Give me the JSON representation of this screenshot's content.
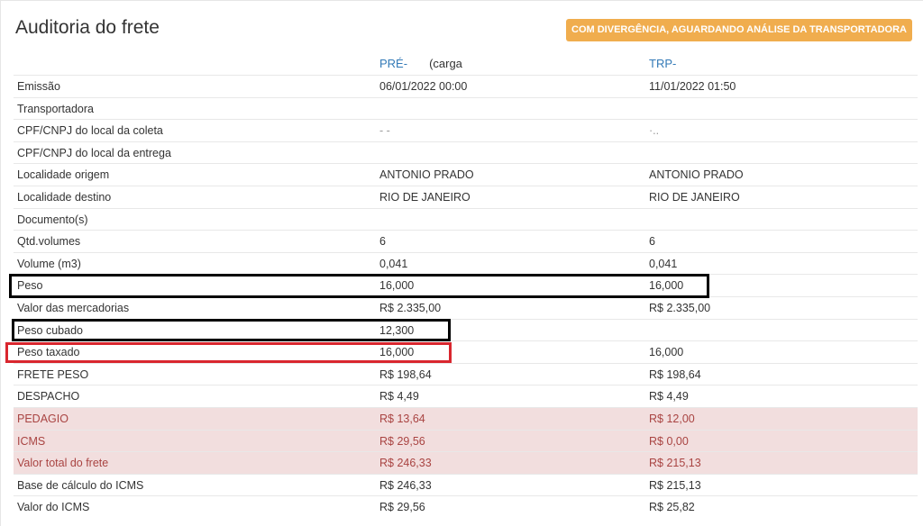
{
  "page": {
    "title": "Auditoria do frete"
  },
  "status_badge": "COM DIVERGÊNCIA, AGUARDANDO ANÁLISE DA TRANSPORTADORA",
  "columns": {
    "pre": {
      "label": "PRÉ-",
      "sub": "(carga"
    },
    "trp": {
      "label": "TRP-"
    }
  },
  "rows": [
    {
      "label": "Emissão",
      "pre": "06/01/2022 00:00",
      "trp": "11/01/2022 01:50",
      "highlight": false
    },
    {
      "label": "Transportadora",
      "pre": "",
      "trp": "",
      "highlight": false
    },
    {
      "label": "CPF/CNPJ do local da coleta",
      "pre": "- -",
      "trp": "·..",
      "highlight": false
    },
    {
      "label": "CPF/CNPJ do local da entrega",
      "pre": "",
      "trp": "",
      "highlight": false
    },
    {
      "label": "Localidade origem",
      "pre": "ANTONIO PRADO",
      "trp": "ANTONIO PRADO",
      "highlight": false
    },
    {
      "label": "Localidade destino",
      "pre": "RIO DE JANEIRO",
      "trp": "RIO DE JANEIRO",
      "highlight": false
    },
    {
      "label": "Documento(s)",
      "pre": "",
      "trp": "",
      "highlight": false
    },
    {
      "label": "Qtd.volumes",
      "pre": "6",
      "trp": "6",
      "highlight": false
    },
    {
      "label": "Volume (m3)",
      "pre": "0,041",
      "trp": "0,041",
      "highlight": false
    },
    {
      "label": "Peso",
      "pre": "16,000",
      "trp": "16,000",
      "highlight": false
    },
    {
      "label": "Valor das mercadorias",
      "pre": "R$ 2.335,00",
      "trp": "R$ 2.335,00",
      "highlight": false
    },
    {
      "label": "Peso cubado",
      "pre": "12,300",
      "trp": "",
      "highlight": false
    },
    {
      "label": "Peso taxado",
      "pre": "16,000",
      "trp": "16,000",
      "highlight": false
    },
    {
      "label": "FRETE PESO",
      "pre": "R$ 198,64",
      "trp": "R$ 198,64",
      "highlight": false
    },
    {
      "label": "DESPACHO",
      "pre": "R$ 4,49",
      "trp": "R$ 4,49",
      "highlight": false
    },
    {
      "label": "PEDAGIO",
      "pre": "R$ 13,64",
      "trp": "R$ 12,00",
      "highlight": true
    },
    {
      "label": "ICMS",
      "pre": "R$ 29,56",
      "trp": "R$ 0,00",
      "highlight": true
    },
    {
      "label": "Valor total do frete",
      "pre": "R$ 246,33",
      "trp": "R$ 215,13",
      "highlight": true
    },
    {
      "label": "Base de cálculo do ICMS",
      "pre": "R$ 246,33",
      "trp": "R$ 215,13",
      "highlight": false
    },
    {
      "label": "Valor do ICMS",
      "pre": "R$ 29,56",
      "trp": "R$ 25,82",
      "highlight": false
    }
  ],
  "colors": {
    "badge": "#f0ad4e",
    "column_header": "#337ab7",
    "divergence_row_bg": "#f2dede",
    "divergence_text": "#a94442",
    "annotation_black": "#000000",
    "annotation_red": "#d9262e"
  }
}
